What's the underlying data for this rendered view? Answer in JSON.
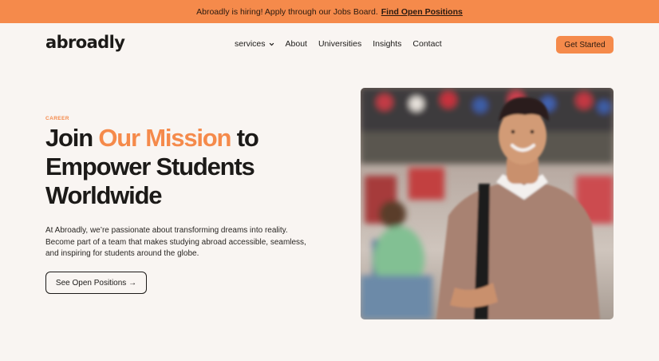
{
  "announcement": {
    "text": "Abroadly is hiring! Apply through our Jobs Board.",
    "link": "Find Open Positions"
  },
  "brand": {
    "logo": "abroadly"
  },
  "nav": {
    "items": [
      "services",
      "About",
      "Universities",
      "Insights",
      "Contact"
    ],
    "services_icon": "chevron-down-icon"
  },
  "header": {
    "cta_label": "Get Started"
  },
  "hero": {
    "eyebrow": "CAREER",
    "headline_part1": "Join ",
    "headline_accent": "Our Mission",
    "headline_part2": " to Empower Students Worldwide",
    "description": "At Abroadly, we’re passionate about transforming dreams into reality. Become part of a team that makes studying abroad accessible, seamless, and inspiring for students around the globe.",
    "button_label": "See Open Positions →"
  },
  "colors": {
    "accent": "#f58a4b",
    "background": "#f9f5f2",
    "text": "#1c1a18"
  }
}
